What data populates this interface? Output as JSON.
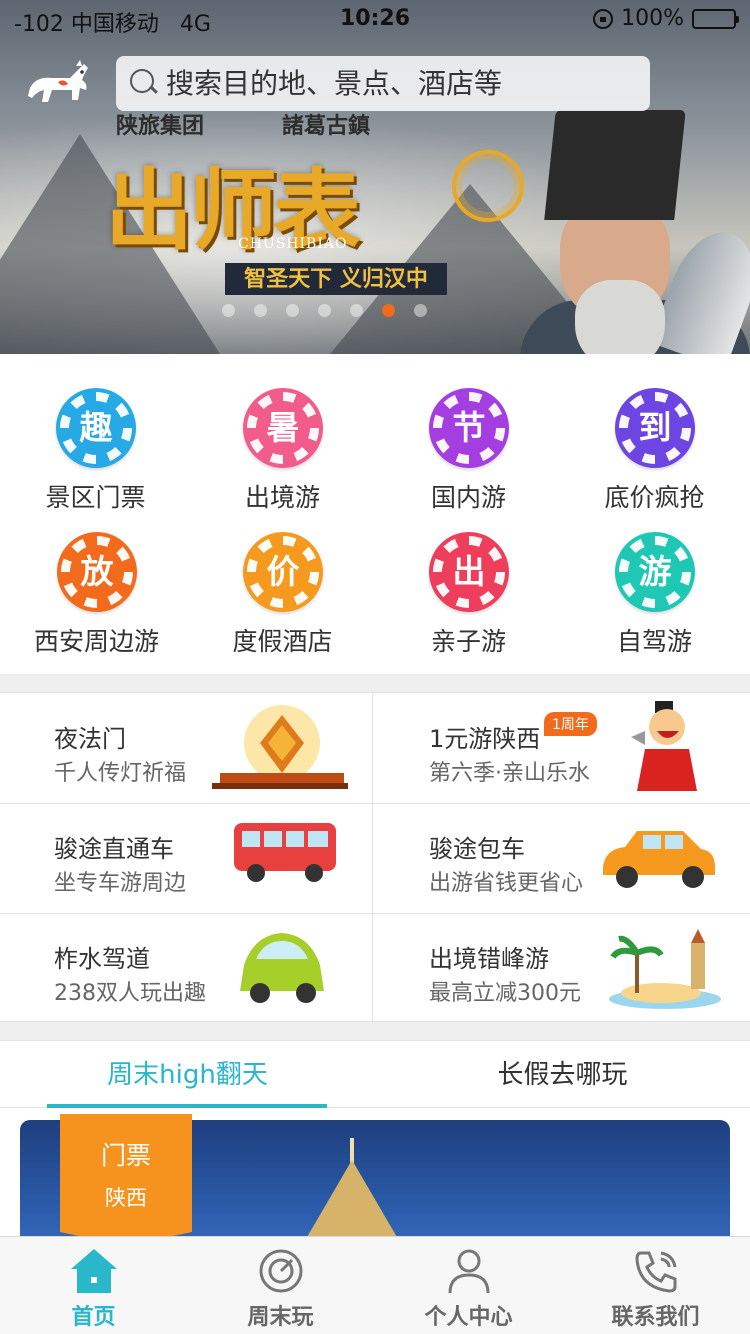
{
  "status_bar": {
    "carrier": "-102 中国移动",
    "network": "4G",
    "time": "10:26",
    "battery": "100%"
  },
  "search": {
    "placeholder": "搜索目的地、景点、酒店等"
  },
  "banner": {
    "logo_left": "陕旅集团",
    "logo_right": "諸葛古鎮",
    "title": "出师表",
    "pinyin": "CHUSHIBIAO",
    "slogan": "智圣天下 义归汉中",
    "slide_count": 7,
    "active_slide": 6
  },
  "categories": [
    {
      "label": "景区门票",
      "badge": "趣",
      "color": "#27a9e6"
    },
    {
      "label": "出境游",
      "badge": "暑",
      "color": "#f25c8a"
    },
    {
      "label": "国内游",
      "badge": "节",
      "color": "#a53ee0"
    },
    {
      "label": "底价疯抢",
      "badge": "到",
      "color": "#6d45e2"
    },
    {
      "label": "西安周边游",
      "badge": "放",
      "color": "#f26b1d"
    },
    {
      "label": "度假酒店",
      "badge": "价",
      "color": "#f59a1e"
    },
    {
      "label": "亲子游",
      "badge": "出",
      "color": "#ef3d5c"
    },
    {
      "label": "自驾游",
      "badge": "游",
      "color": "#1fc8b4"
    }
  ],
  "features": [
    {
      "title": "夜法门",
      "subtitle": "千人传灯祈福",
      "image": "temple-illustration"
    },
    {
      "title": "1元游陕西",
      "subtitle": "第六季·亲山乐水",
      "image": "mascot-illustration",
      "badge": "1周年"
    },
    {
      "title": "骏途直通车",
      "subtitle": "坐专车游周边",
      "image": "bus-illustration"
    },
    {
      "title": "骏途包车",
      "subtitle": "出游省钱更省心",
      "image": "car-illustration"
    },
    {
      "title": "柞水驾道",
      "subtitle": "238双人玩出趣",
      "image": "green-car-illustration"
    },
    {
      "title": "出境错峰游",
      "subtitle": "最高立减300元",
      "image": "island-illustration"
    }
  ],
  "tabs": [
    {
      "label": "周末high翻天",
      "active": true
    },
    {
      "label": "长假去哪玩",
      "active": false
    }
  ],
  "card": {
    "tag_title": "门票",
    "tag_region": "陕西"
  },
  "bottom_nav": [
    {
      "label": "首页",
      "icon": "home-icon",
      "active": true
    },
    {
      "label": "周末玩",
      "icon": "compass-icon",
      "active": false
    },
    {
      "label": "个人中心",
      "icon": "user-icon",
      "active": false
    },
    {
      "label": "联系我们",
      "icon": "phone-icon",
      "active": false
    }
  ],
  "colors": {
    "accent": "#29b7cb",
    "orange": "#f26a1b",
    "tag": "#f6931e"
  }
}
